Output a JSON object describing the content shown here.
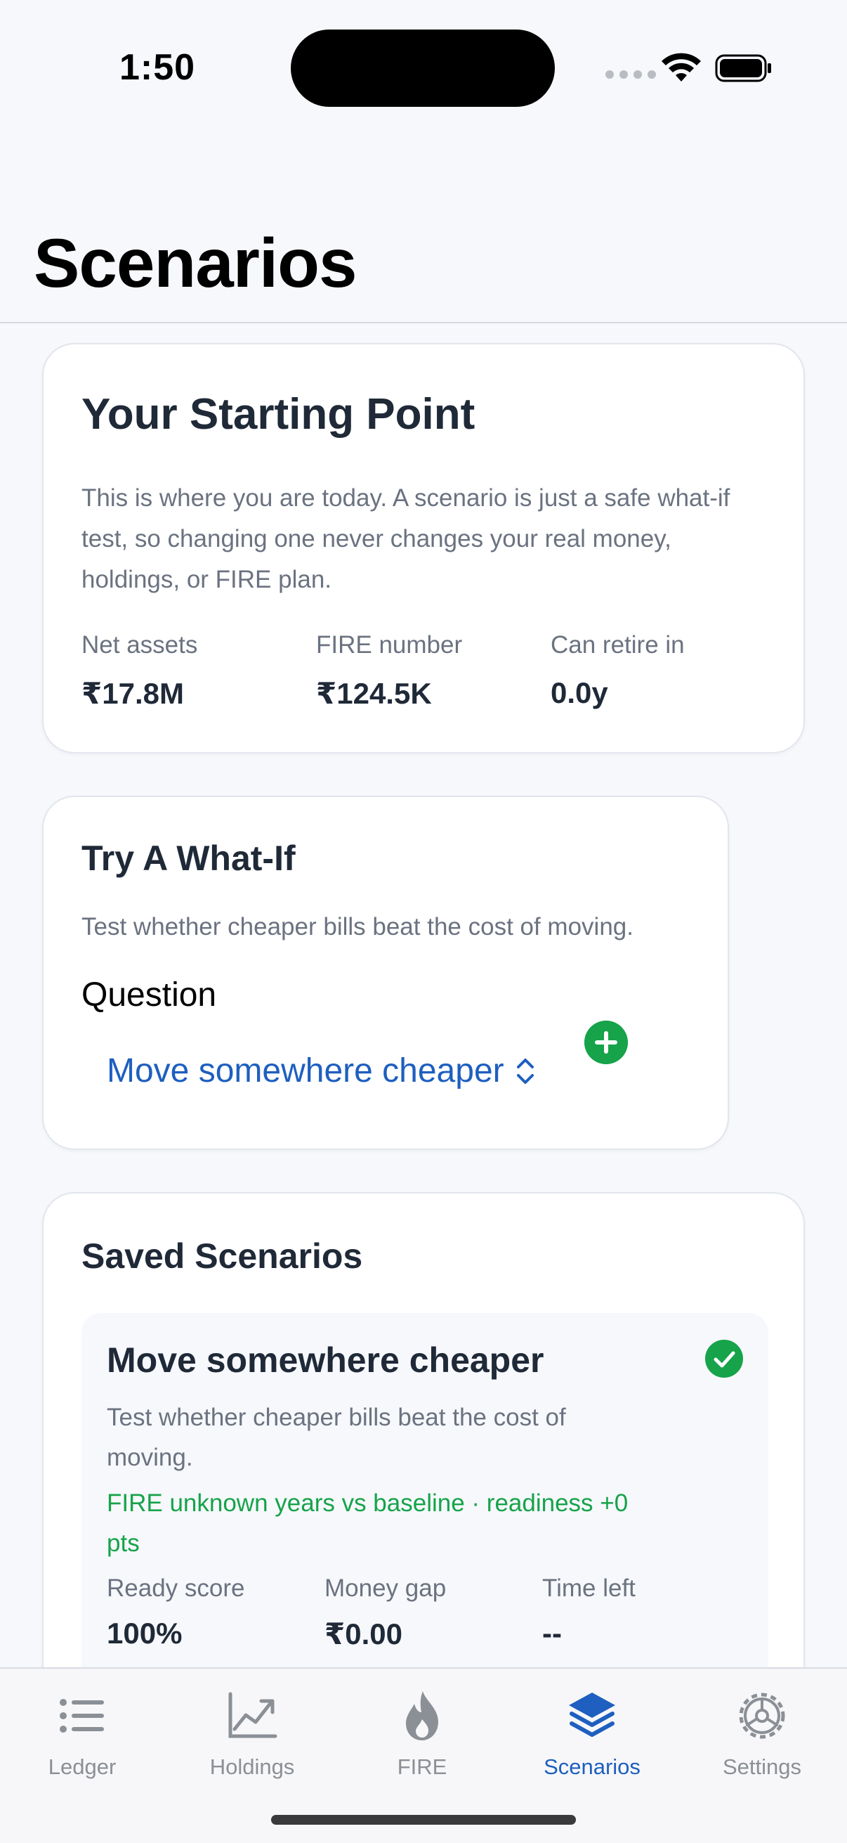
{
  "status_bar": {
    "time": "1:50"
  },
  "page": {
    "title": "Scenarios"
  },
  "starting_point": {
    "title": "Your Starting Point",
    "description": "This is where you are today. A scenario is just a safe what-if test, so changing one never changes your real money, holdings, or FIRE plan.",
    "stats": [
      {
        "label": "Net assets",
        "value": "₹17.8M"
      },
      {
        "label": "FIRE number",
        "value": "₹124.5K"
      },
      {
        "label": "Can retire in",
        "value": "0.0y"
      }
    ]
  },
  "what_if": {
    "title": "Try A What-If",
    "description": "Test whether cheaper bills beat the cost of moving.",
    "question_label": "Question",
    "selected_question": "Move somewhere cheaper"
  },
  "saved": {
    "title": "Saved Scenarios",
    "items": [
      {
        "title": "Move somewhere cheaper",
        "description": "Test whether cheaper bills beat the cost of moving.",
        "delta": "FIRE unknown years vs baseline · readiness +0 pts",
        "stats": [
          {
            "label": "Ready score",
            "value": "100%"
          },
          {
            "label": "Money gap",
            "value": "₹0.00"
          },
          {
            "label": "Time left",
            "value": "--"
          }
        ]
      }
    ]
  },
  "tabs": [
    {
      "label": "Ledger",
      "icon": "list-icon",
      "active": false
    },
    {
      "label": "Holdings",
      "icon": "chart-line-icon",
      "active": false
    },
    {
      "label": "FIRE",
      "icon": "flame-icon",
      "active": false
    },
    {
      "label": "Scenarios",
      "icon": "layers-icon",
      "active": true
    },
    {
      "label": "Settings",
      "icon": "gear-icon",
      "active": false
    }
  ],
  "colors": {
    "accent": "#1e5fbf",
    "success": "#16a34a",
    "inactive_tab": "#8b8f96",
    "background": "#f6f8fb"
  }
}
